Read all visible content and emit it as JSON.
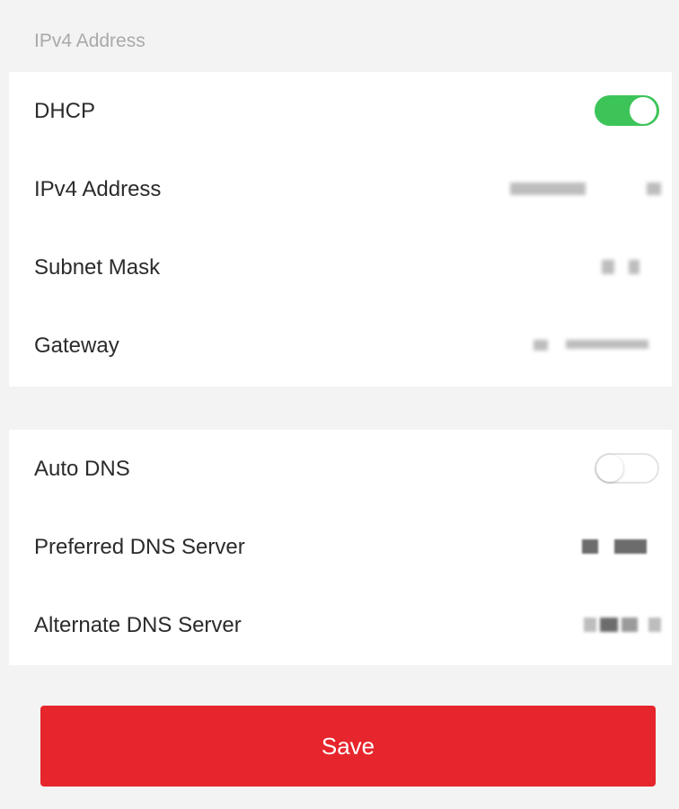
{
  "section": {
    "title": "IPv4 Address"
  },
  "network": {
    "dhcp": {
      "label": "DHCP",
      "enabled": true
    },
    "ipv4_address": {
      "label": "IPv4 Address"
    },
    "subnet_mask": {
      "label": "Subnet Mask"
    },
    "gateway": {
      "label": "Gateway"
    }
  },
  "dns": {
    "auto_dns": {
      "label": "Auto DNS",
      "enabled": false
    },
    "preferred": {
      "label": "Preferred DNS Server"
    },
    "alternate": {
      "label": "Alternate DNS Server"
    }
  },
  "actions": {
    "save_label": "Save"
  },
  "colors": {
    "accent_red": "#e6262c",
    "toggle_on_green": "#3dc459",
    "background": "#f3f3f3"
  }
}
